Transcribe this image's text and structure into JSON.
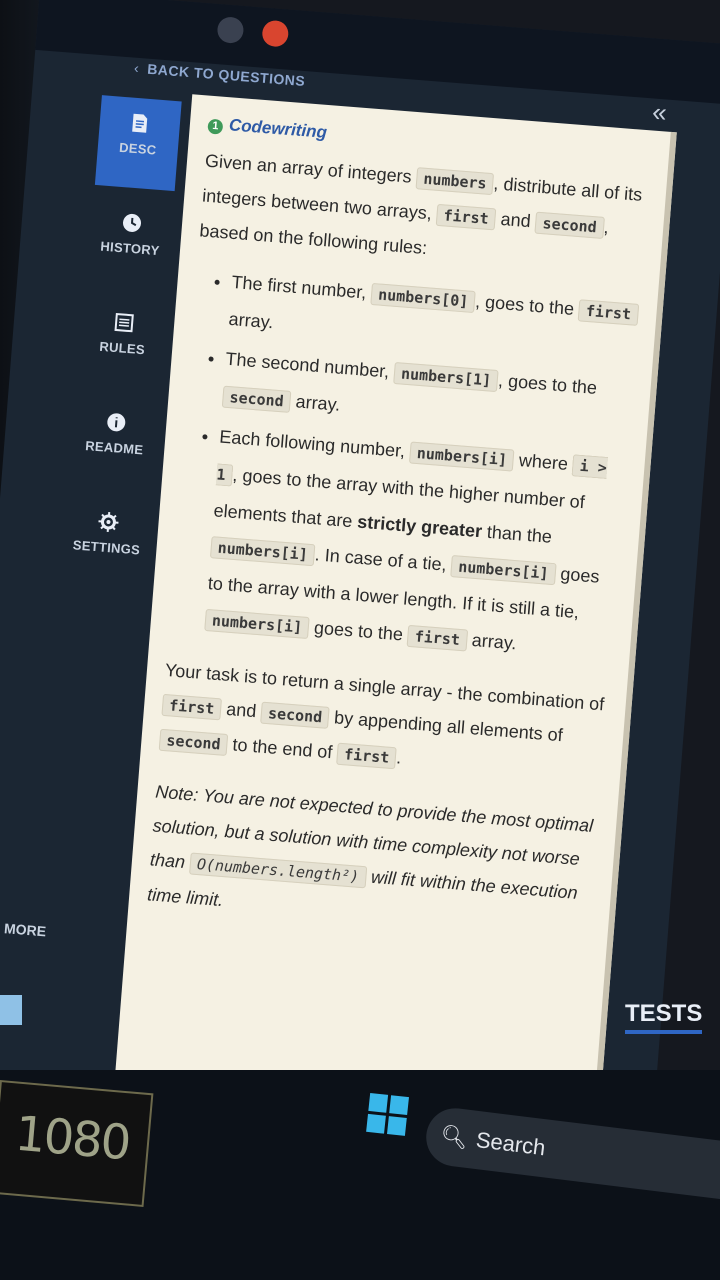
{
  "nav": {
    "back_label": "BACK TO QUESTIONS",
    "collapse_label": "«",
    "more_label": "MORE",
    "tests_label": "TESTS"
  },
  "sidebar": {
    "items": [
      {
        "label": "DESC",
        "icon": "document-icon",
        "active": true
      },
      {
        "label": "HISTORY",
        "icon": "clock-icon",
        "active": false
      },
      {
        "label": "RULES",
        "icon": "list-icon",
        "active": false
      },
      {
        "label": "README",
        "icon": "info-icon",
        "active": false
      },
      {
        "label": "SETTINGS",
        "icon": "gear-icon",
        "active": false
      }
    ]
  },
  "task": {
    "number": "1",
    "title": "Codewriting",
    "intro": {
      "t1": "Given an array of integers ",
      "c1": "numbers",
      "t2": ", distribute all of its integers between two arrays, ",
      "c2": "first",
      "t3": " and ",
      "c3": "second",
      "t4": ", based on the following rules:"
    },
    "rules": [
      {
        "t1": "The first number, ",
        "c1": "numbers[0]",
        "t2": ", goes to the ",
        "c2": "first",
        "t3": " array."
      },
      {
        "t1": "The second number, ",
        "c1": "numbers[1]",
        "t2": ", goes to the ",
        "c2": "second",
        "t3": " array."
      },
      {
        "t1": "Each following number, ",
        "c1": "numbers[i]",
        "t2": " where ",
        "c2": "i > 1",
        "t3": ", goes to the array with the higher number of elements that are ",
        "strong": "strictly greater",
        "t4": " than the ",
        "c3": "numbers[i]",
        "t5": ". In case of a tie, ",
        "c4": "numbers[i]",
        "t6": " goes to the array with a lower length. If it is still a tie, ",
        "c5": "numbers[i]",
        "t7": " goes to the ",
        "c6": "first",
        "t8": " array."
      }
    ],
    "return": {
      "t1": "Your task is to return a single array - the combination of ",
      "c1": "first",
      "t2": " and ",
      "c2": "second",
      "t3": " by appending all elements of ",
      "c3": "second",
      "t4": " to the end of ",
      "c4": "first",
      "t5": "."
    },
    "note": {
      "t1": "Note: You are not expected to provide the most optimal solution, but a solution with time complexity not worse than ",
      "c1": "O(numbers.length²)",
      "t2": " will fit within the execution time limit."
    }
  },
  "taskbar": {
    "search_label": "Search",
    "resolution_label": "1080"
  },
  "colors": {
    "accent": "#2f66c4",
    "panel_bg": "#f5f1e3",
    "sidebar_text": "#c9d3e0"
  }
}
